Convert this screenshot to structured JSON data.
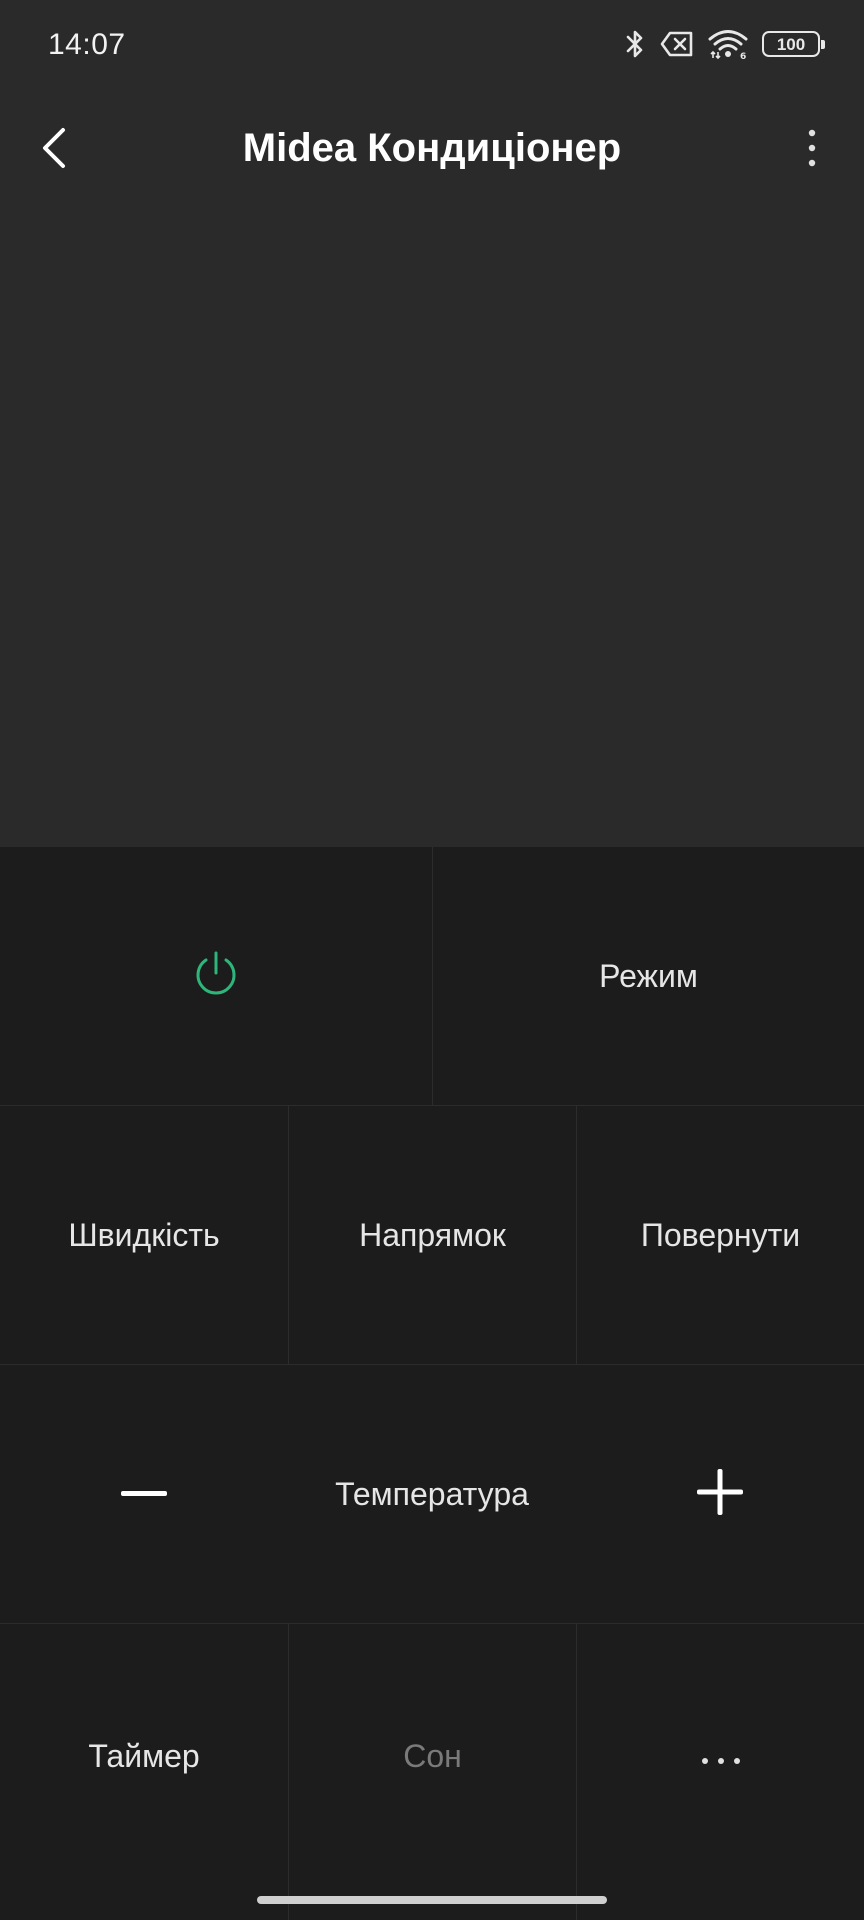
{
  "status_bar": {
    "time": "14:07",
    "battery_level": "100",
    "icons": [
      "bluetooth-icon",
      "no-sim-icon",
      "wifi-icon",
      "battery-icon"
    ]
  },
  "header": {
    "title": "Midea Кондиціонер",
    "back_icon": "chevron-left-icon",
    "more_icon": "more-vertical-icon"
  },
  "remote": {
    "power_icon": "power-icon",
    "power_color": "#2db57a",
    "mode_label": "Режим",
    "speed_label": "Швидкість",
    "direction_label": "Напрямок",
    "swing_label": "Повернути",
    "temperature_label": "Температура",
    "minus_icon": "minus-icon",
    "plus_icon": "plus-icon",
    "timer_label": "Таймер",
    "sleep_label": "Сон",
    "more_icon": "more-horizontal-icon"
  },
  "colors": {
    "background": "#2a2a2a",
    "panel": "#1c1c1c",
    "accent": "#2db57a",
    "disabled_text": "#7a7a7a"
  }
}
